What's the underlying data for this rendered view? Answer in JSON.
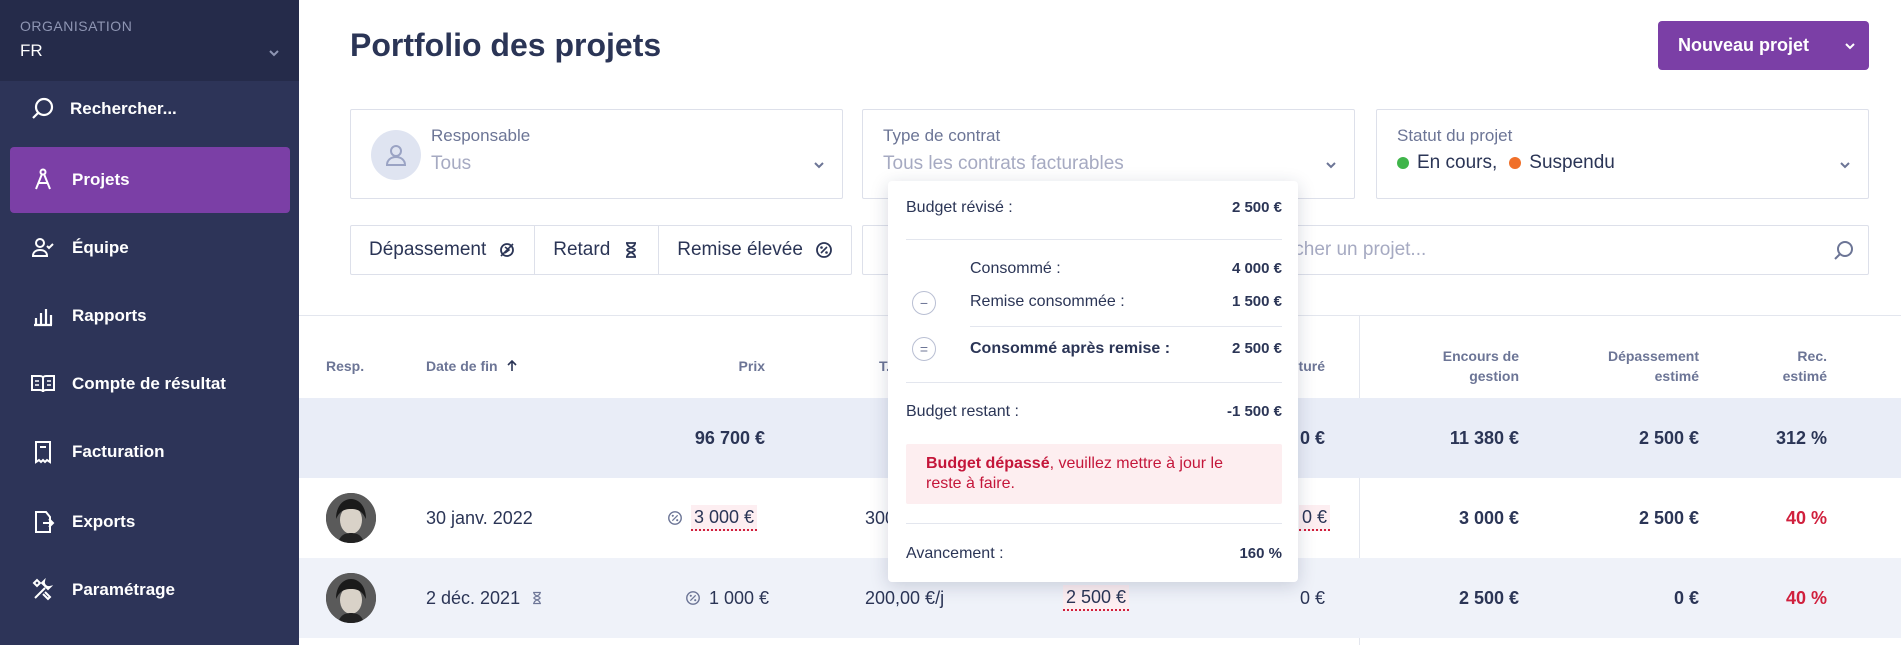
{
  "sidebar": {
    "org_label": "ORGANISATION",
    "org_value": "FR",
    "search_label": "Rechercher...",
    "items": [
      {
        "label": "Projets"
      },
      {
        "label": "Équipe"
      },
      {
        "label": "Rapports"
      },
      {
        "label": "Compte de résultat"
      },
      {
        "label": "Facturation"
      },
      {
        "label": "Exports"
      },
      {
        "label": "Paramétrage"
      }
    ],
    "active_index": 0
  },
  "header": {
    "title": "Portfolio des projets",
    "new_button": "Nouveau projet"
  },
  "filters": {
    "responsable": {
      "label": "Responsable",
      "value": "Tous"
    },
    "contrat": {
      "label": "Type de contrat",
      "value": "Tous les contrats facturables"
    },
    "statut": {
      "label": "Statut du projet",
      "values": [
        "En cours,",
        "Suspendu"
      ]
    }
  },
  "quick_filters": [
    "Dépassement",
    "Retard",
    "Remise élevée"
  ],
  "search": {
    "placeholder": "Rechercher un projet..."
  },
  "table": {
    "columns": {
      "resp": "Resp.",
      "date_fin": "Date de fin",
      "prix": "Prix",
      "tjm": "T.",
      "facture": "cturé",
      "encours": [
        "Encours de",
        "gestion"
      ],
      "depassement": [
        "Dépassement",
        "estimé"
      ],
      "rec": [
        "Rec.",
        "estimé"
      ]
    },
    "total": {
      "prix": "96 700 €",
      "facture": "0 €",
      "encours": "11 380 €",
      "depassement": "2 500 €",
      "rec": "312 %"
    },
    "rows": [
      {
        "date": "30 janv. 2022",
        "prix": "3 000 €",
        "tjm": "300",
        "facture": "0 €",
        "encours": "3 000 €",
        "depassement": "2 500 €",
        "rec": "40 %"
      },
      {
        "date": "2 déc. 2021",
        "prix": "1 000 €",
        "tjm": "200,00 €/j",
        "consomme": "2 500 €",
        "facture": "0 €",
        "encours": "2 500 €",
        "depassement": "0 €",
        "rec": "40 %"
      }
    ]
  },
  "popover": {
    "budget_revise_label": "Budget révisé :",
    "budget_revise": "2 500 €",
    "consomme_label": "Consommé :",
    "consomme": "4 000 €",
    "remise_label": "Remise consommée :",
    "remise": "1 500 €",
    "apres_remise_label": "Consommé après remise :",
    "apres_remise": "2 500 €",
    "restant_label": "Budget restant :",
    "restant": "-1 500 €",
    "warning_bold": "Budget dépassé",
    "warning_rest": ", veuillez mettre à jour le reste à faire.",
    "avancement_label": "Avancement :",
    "avancement": "160 %",
    "minus_sign": "−",
    "equals_sign": "="
  },
  "colors": {
    "sidebar_bg": "#2d3458",
    "accent": "#7b3fa6",
    "danger": "#d0203d",
    "status_en_cours": "#3fb54a",
    "status_suspendu": "#f0702a"
  }
}
